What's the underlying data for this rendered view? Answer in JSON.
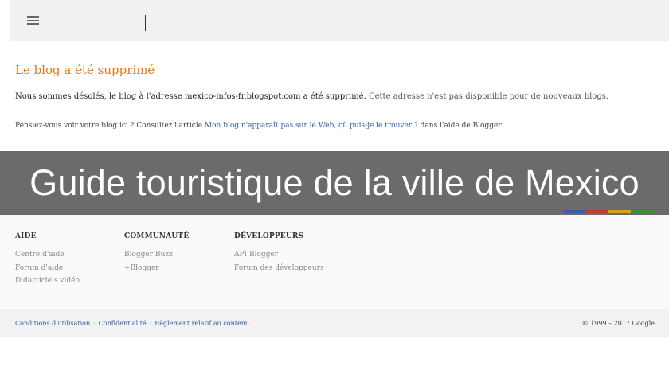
{
  "message": {
    "title": "Le blog a été supprimé",
    "line_main": "Nous sommes désolés, le blog à l'adresse mexico-infos-fr.blogspot.com a été supprimé.",
    "line_rest": "Cette adresse n'est pas disponible pour de nouveaux blogs.",
    "hint_prefix": "Pensiez-vous voir votre blog ici ? Consultez l'article",
    "hint_link": "Mon blog n'apparaît pas sur le Web, où puis-je le trouver ?",
    "hint_suffix": "dans l'aide de Blogger."
  },
  "banner": {
    "title": "Guide touristique de la ville de Mexico"
  },
  "color_strip": [
    "#3b5fa9",
    "#c23a3a",
    "#d8a21b",
    "#3b8d3a"
  ],
  "footer": {
    "aide": {
      "heading": "AIDE",
      "links": [
        "Centre d'aide",
        "Forum d'aide",
        "Didacticiels vidéo"
      ]
    },
    "communaute": {
      "heading": "COMMUNAUTÉ",
      "links": [
        "Blogger Buzz",
        "+Blogger"
      ]
    },
    "developpeurs": {
      "heading": "DÉVELOPPEURS",
      "links": [
        "API Blogger",
        "Forum des développeurs"
      ]
    }
  },
  "bottom": {
    "links": [
      "Conditions d'utilisation",
      "Confidentialité",
      "Règlement relatif au contenu"
    ],
    "separator": "·",
    "copyright": "© 1999 – 2017 Google"
  }
}
